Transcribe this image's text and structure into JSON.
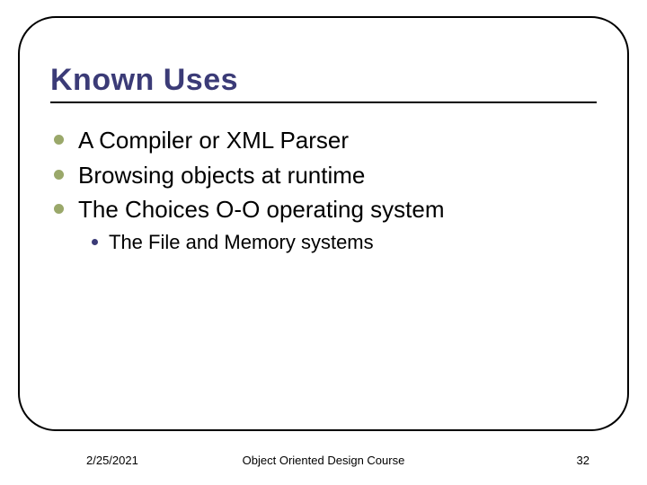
{
  "title": "Known Uses",
  "bullets": [
    {
      "text": "A Compiler or XML Parser"
    },
    {
      "text": "Browsing objects at runtime"
    },
    {
      "text": "The Choices O-O operating system",
      "sub": [
        {
          "text": "The File and Memory systems"
        }
      ]
    }
  ],
  "footer": {
    "date": "2/25/2021",
    "course": "Object Oriented Design Course",
    "page": "32"
  }
}
